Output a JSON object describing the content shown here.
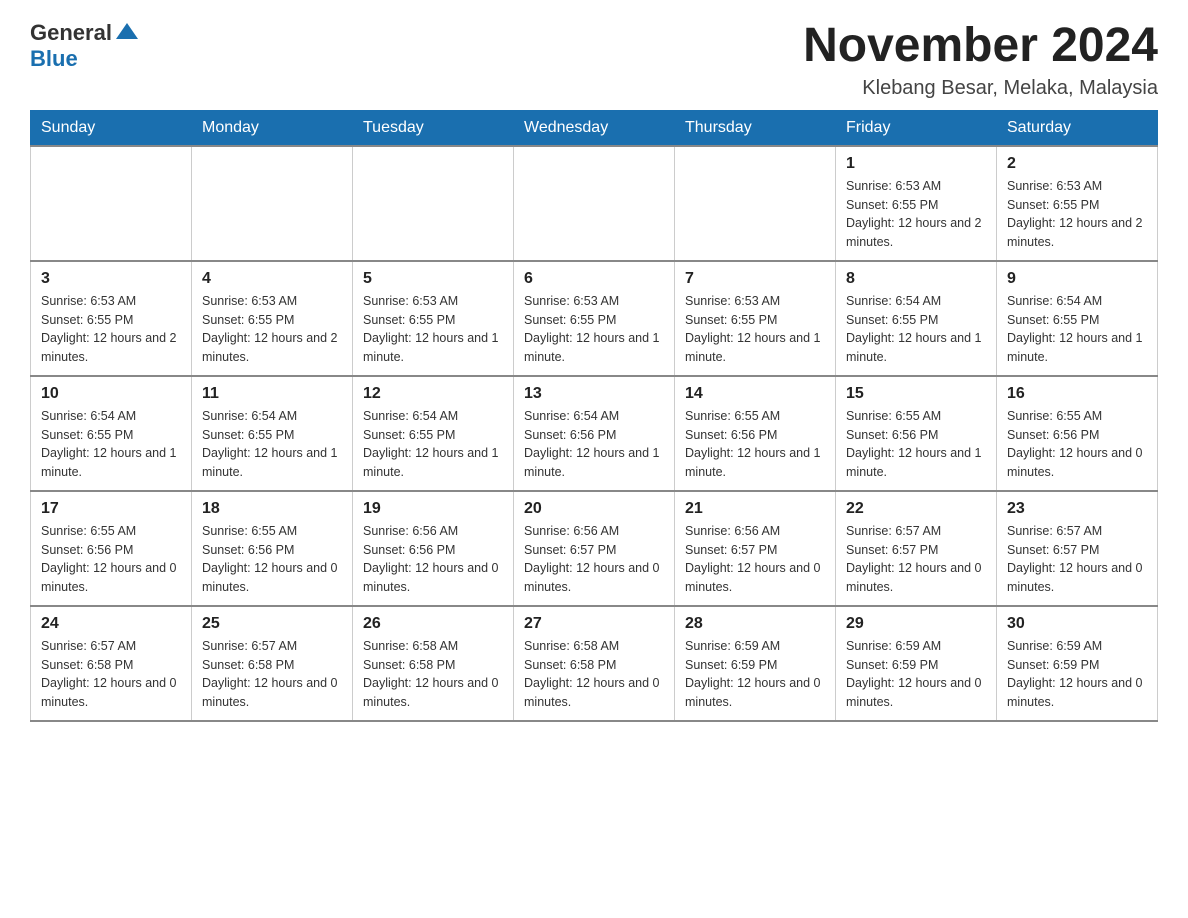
{
  "header": {
    "logo": {
      "general": "General",
      "blue": "Blue",
      "tagline": ""
    },
    "title": "November 2024",
    "location": "Klebang Besar, Melaka, Malaysia"
  },
  "calendar": {
    "days_of_week": [
      "Sunday",
      "Monday",
      "Tuesday",
      "Wednesday",
      "Thursday",
      "Friday",
      "Saturday"
    ],
    "weeks": [
      [
        {
          "day": "",
          "info": ""
        },
        {
          "day": "",
          "info": ""
        },
        {
          "day": "",
          "info": ""
        },
        {
          "day": "",
          "info": ""
        },
        {
          "day": "",
          "info": ""
        },
        {
          "day": "1",
          "info": "Sunrise: 6:53 AM\nSunset: 6:55 PM\nDaylight: 12 hours and 2 minutes."
        },
        {
          "day": "2",
          "info": "Sunrise: 6:53 AM\nSunset: 6:55 PM\nDaylight: 12 hours and 2 minutes."
        }
      ],
      [
        {
          "day": "3",
          "info": "Sunrise: 6:53 AM\nSunset: 6:55 PM\nDaylight: 12 hours and 2 minutes."
        },
        {
          "day": "4",
          "info": "Sunrise: 6:53 AM\nSunset: 6:55 PM\nDaylight: 12 hours and 2 minutes."
        },
        {
          "day": "5",
          "info": "Sunrise: 6:53 AM\nSunset: 6:55 PM\nDaylight: 12 hours and 1 minute."
        },
        {
          "day": "6",
          "info": "Sunrise: 6:53 AM\nSunset: 6:55 PM\nDaylight: 12 hours and 1 minute."
        },
        {
          "day": "7",
          "info": "Sunrise: 6:53 AM\nSunset: 6:55 PM\nDaylight: 12 hours and 1 minute."
        },
        {
          "day": "8",
          "info": "Sunrise: 6:54 AM\nSunset: 6:55 PM\nDaylight: 12 hours and 1 minute."
        },
        {
          "day": "9",
          "info": "Sunrise: 6:54 AM\nSunset: 6:55 PM\nDaylight: 12 hours and 1 minute."
        }
      ],
      [
        {
          "day": "10",
          "info": "Sunrise: 6:54 AM\nSunset: 6:55 PM\nDaylight: 12 hours and 1 minute."
        },
        {
          "day": "11",
          "info": "Sunrise: 6:54 AM\nSunset: 6:55 PM\nDaylight: 12 hours and 1 minute."
        },
        {
          "day": "12",
          "info": "Sunrise: 6:54 AM\nSunset: 6:55 PM\nDaylight: 12 hours and 1 minute."
        },
        {
          "day": "13",
          "info": "Sunrise: 6:54 AM\nSunset: 6:56 PM\nDaylight: 12 hours and 1 minute."
        },
        {
          "day": "14",
          "info": "Sunrise: 6:55 AM\nSunset: 6:56 PM\nDaylight: 12 hours and 1 minute."
        },
        {
          "day": "15",
          "info": "Sunrise: 6:55 AM\nSunset: 6:56 PM\nDaylight: 12 hours and 1 minute."
        },
        {
          "day": "16",
          "info": "Sunrise: 6:55 AM\nSunset: 6:56 PM\nDaylight: 12 hours and 0 minutes."
        }
      ],
      [
        {
          "day": "17",
          "info": "Sunrise: 6:55 AM\nSunset: 6:56 PM\nDaylight: 12 hours and 0 minutes."
        },
        {
          "day": "18",
          "info": "Sunrise: 6:55 AM\nSunset: 6:56 PM\nDaylight: 12 hours and 0 minutes."
        },
        {
          "day": "19",
          "info": "Sunrise: 6:56 AM\nSunset: 6:56 PM\nDaylight: 12 hours and 0 minutes."
        },
        {
          "day": "20",
          "info": "Sunrise: 6:56 AM\nSunset: 6:57 PM\nDaylight: 12 hours and 0 minutes."
        },
        {
          "day": "21",
          "info": "Sunrise: 6:56 AM\nSunset: 6:57 PM\nDaylight: 12 hours and 0 minutes."
        },
        {
          "day": "22",
          "info": "Sunrise: 6:57 AM\nSunset: 6:57 PM\nDaylight: 12 hours and 0 minutes."
        },
        {
          "day": "23",
          "info": "Sunrise: 6:57 AM\nSunset: 6:57 PM\nDaylight: 12 hours and 0 minutes."
        }
      ],
      [
        {
          "day": "24",
          "info": "Sunrise: 6:57 AM\nSunset: 6:58 PM\nDaylight: 12 hours and 0 minutes."
        },
        {
          "day": "25",
          "info": "Sunrise: 6:57 AM\nSunset: 6:58 PM\nDaylight: 12 hours and 0 minutes."
        },
        {
          "day": "26",
          "info": "Sunrise: 6:58 AM\nSunset: 6:58 PM\nDaylight: 12 hours and 0 minutes."
        },
        {
          "day": "27",
          "info": "Sunrise: 6:58 AM\nSunset: 6:58 PM\nDaylight: 12 hours and 0 minutes."
        },
        {
          "day": "28",
          "info": "Sunrise: 6:59 AM\nSunset: 6:59 PM\nDaylight: 12 hours and 0 minutes."
        },
        {
          "day": "29",
          "info": "Sunrise: 6:59 AM\nSunset: 6:59 PM\nDaylight: 12 hours and 0 minutes."
        },
        {
          "day": "30",
          "info": "Sunrise: 6:59 AM\nSunset: 6:59 PM\nDaylight: 12 hours and 0 minutes."
        }
      ]
    ]
  }
}
